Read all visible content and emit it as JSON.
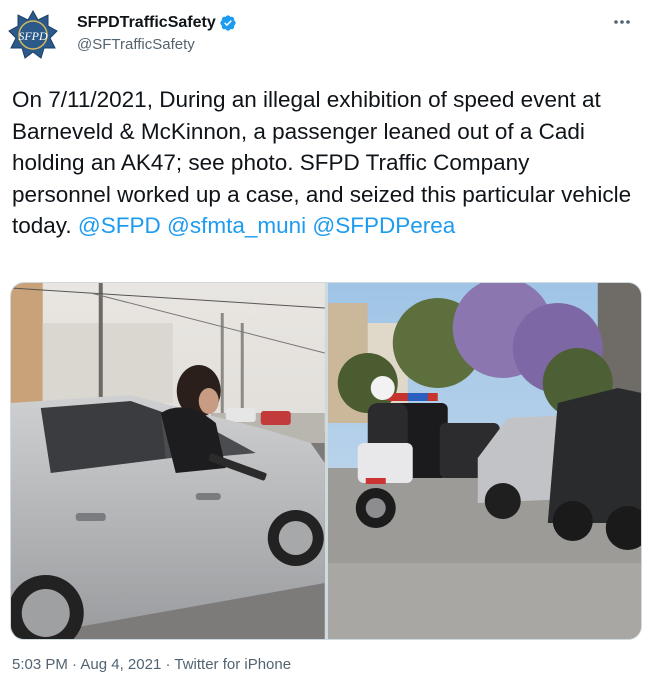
{
  "author": {
    "display_name": "SFPDTrafficSafety",
    "handle": "@SFTrafficSafety",
    "avatar_text": "SFPD",
    "verified": true
  },
  "tweet": {
    "text_before": "On 7/11/2021, During an illegal exhibition of speed event at Barneveld & McKinnon, a passenger leaned out of a Cadi holding an AK47; see photo. SFPD Traffic Company personnel worked up a case, and seized this particular vehicle today. ",
    "mentions": [
      "@SFPD",
      "@sfmta_muni",
      "@SFPDPerea"
    ]
  },
  "meta": {
    "time": "5:03 PM",
    "date": "Aug 4, 2021",
    "source": "Twitter for iPhone",
    "separator": " · "
  },
  "colors": {
    "link": "#1d9bf0",
    "secondary_text": "#536471",
    "avatar_blue": "#2b5a8a",
    "verified_blue": "#1d9bf0"
  },
  "icons": [
    "sfpd-star-badge-icon",
    "verified-badge-icon",
    "more-options-icon"
  ]
}
